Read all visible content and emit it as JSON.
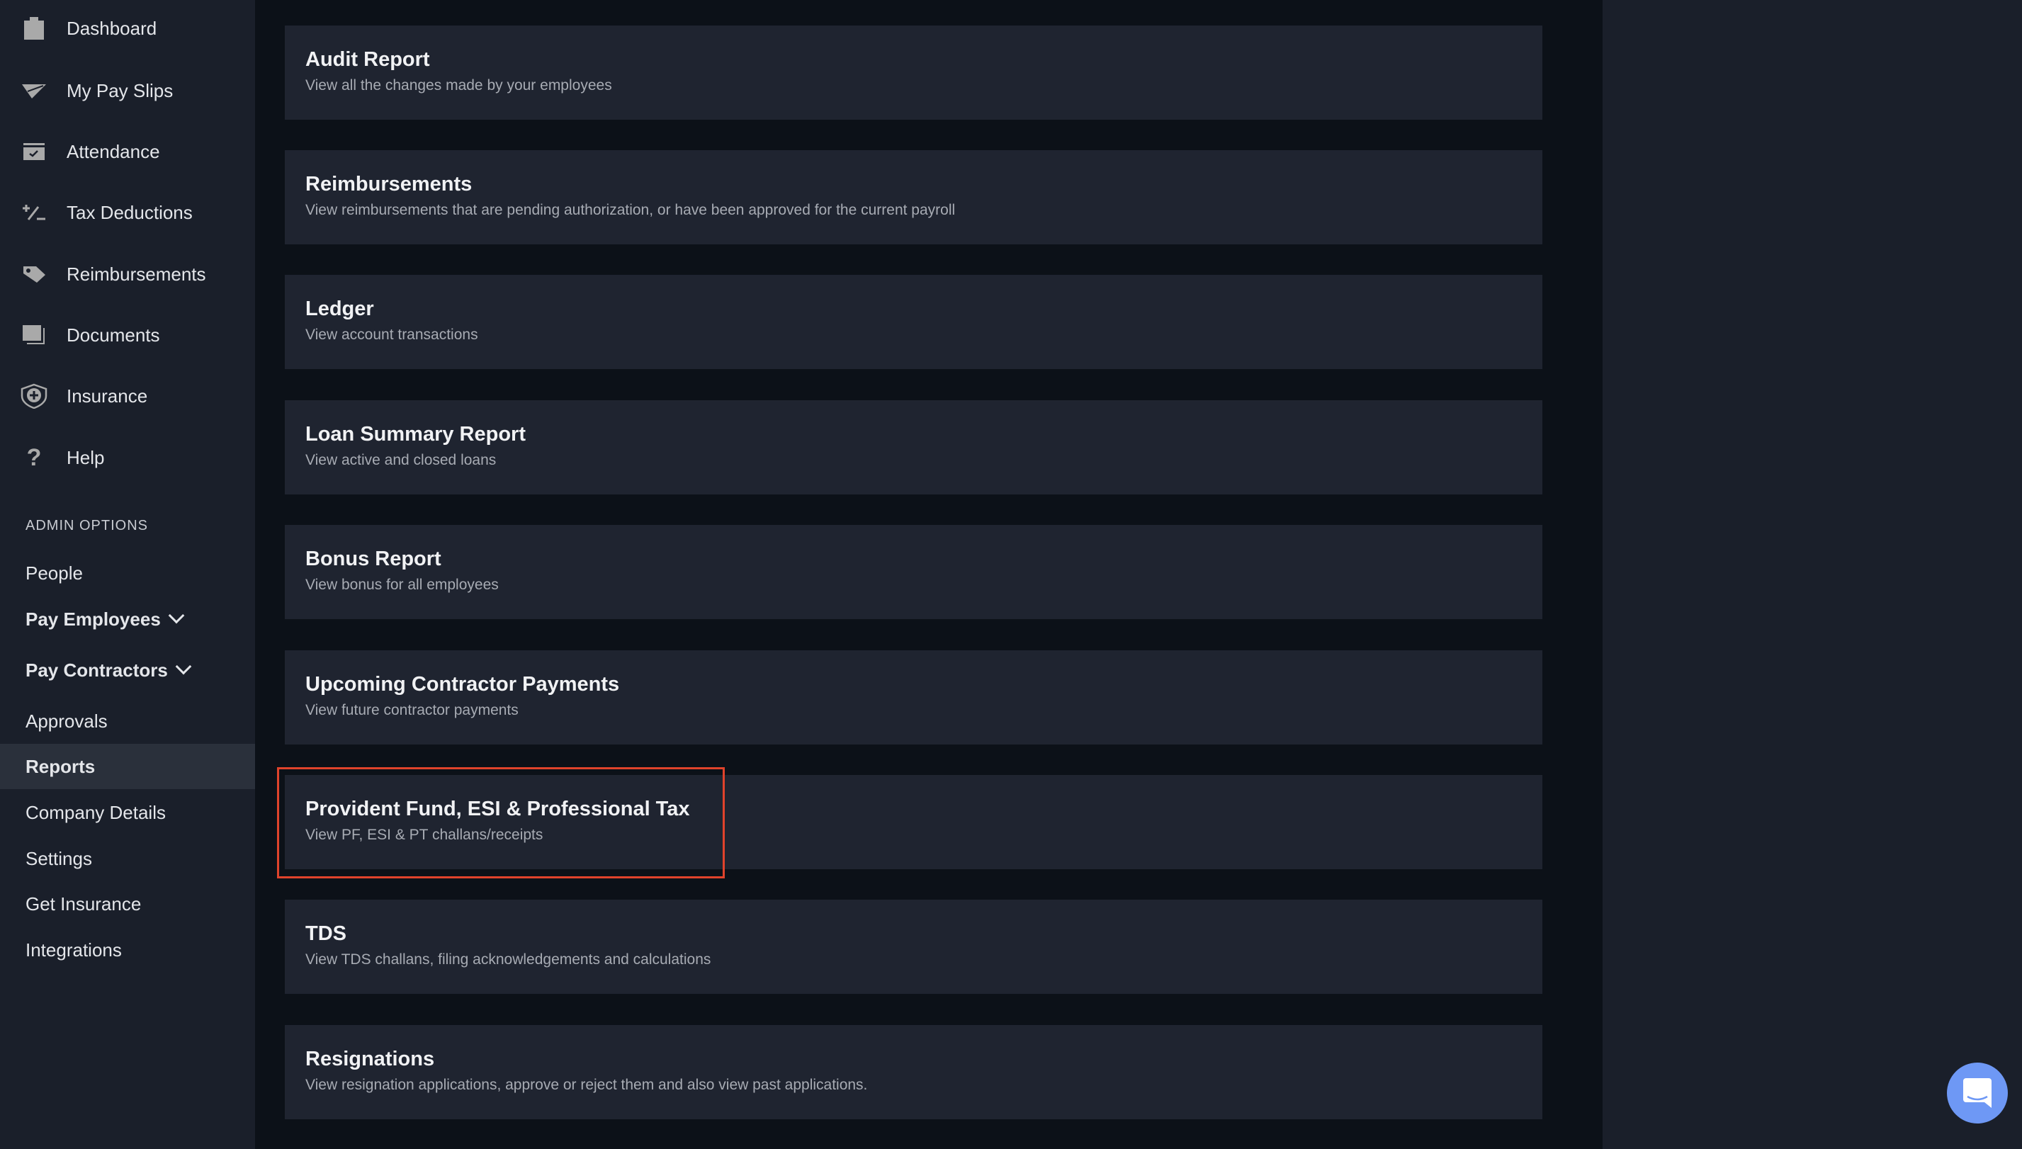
{
  "sidebar": {
    "items": [
      {
        "label": "Dashboard",
        "icon": "clipboard-icon"
      },
      {
        "label": "My Pay Slips",
        "icon": "paper-plane-icon"
      },
      {
        "label": "Attendance",
        "icon": "calendar-check-icon"
      },
      {
        "label": "Tax Deductions",
        "icon": "plus-minus-icon"
      },
      {
        "label": "Reimbursements",
        "icon": "tag-icon"
      },
      {
        "label": "Documents",
        "icon": "documents-icon"
      },
      {
        "label": "Insurance",
        "icon": "shield-plus-icon"
      },
      {
        "label": "Help",
        "icon": "question-icon"
      }
    ],
    "admin_heading": "ADMIN OPTIONS",
    "admin_items": [
      {
        "label": "People"
      },
      {
        "label": "Pay Employees"
      },
      {
        "label": "Pay Contractors"
      },
      {
        "label": "Approvals"
      },
      {
        "label": "Reports"
      },
      {
        "label": "Company Details"
      },
      {
        "label": "Settings"
      },
      {
        "label": "Get Insurance"
      },
      {
        "label": "Integrations"
      }
    ],
    "active": "Reports"
  },
  "reports": [
    {
      "title": "Audit Report",
      "desc": "View all the changes made by your employees"
    },
    {
      "title": "Reimbursements",
      "desc": "View reimbursements that are pending authorization, or have been approved for the current payroll"
    },
    {
      "title": "Ledger",
      "desc": "View account transactions"
    },
    {
      "title": "Loan Summary Report",
      "desc": "View active and closed loans"
    },
    {
      "title": "Bonus Report",
      "desc": "View bonus for all employees"
    },
    {
      "title": "Upcoming Contractor Payments",
      "desc": "View future contractor payments"
    },
    {
      "title": "Provident Fund, ESI & Professional Tax",
      "desc": "View PF, ESI & PT challans/receipts"
    },
    {
      "title": "TDS",
      "desc": "View TDS challans, filing acknowledgements and calculations"
    },
    {
      "title": "Resignations",
      "desc": "View resignation applications, approve or reject them and also view past applications."
    }
  ],
  "colors": {
    "highlight": "#e0432b",
    "chat": "#6e98f5"
  }
}
